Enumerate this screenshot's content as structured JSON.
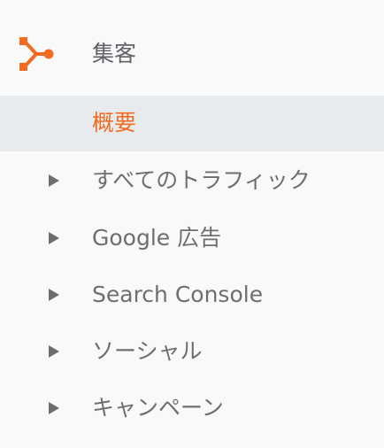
{
  "section": {
    "title": "集客",
    "icon": "acquisition-fork-icon",
    "accent_color": "#f26b21"
  },
  "active_item": {
    "label": "概要",
    "background": "#e8ebee"
  },
  "items": [
    {
      "label": "すべてのトラフィック",
      "icon": "expand-arrow-icon"
    },
    {
      "label": "Google 広告",
      "icon": "expand-arrow-icon"
    },
    {
      "label": "Search Console",
      "icon": "expand-arrow-icon"
    },
    {
      "label": "ソーシャル",
      "icon": "expand-arrow-icon"
    },
    {
      "label": "キャンペーン",
      "icon": "expand-arrow-icon"
    }
  ]
}
